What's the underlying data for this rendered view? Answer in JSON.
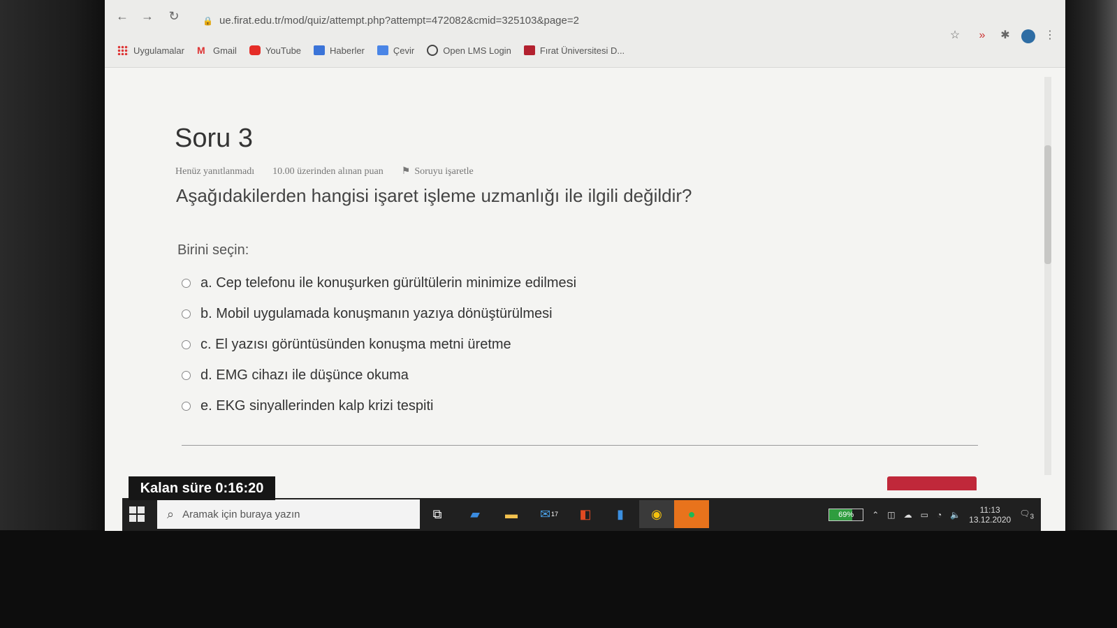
{
  "browser": {
    "url": "ue.firat.edu.tr/mod/quiz/attempt.php?attempt=472082&cmid=325103&page=2",
    "bookmarks": [
      {
        "label": "Uygulamalar",
        "icon": "apps-grid-icon"
      },
      {
        "label": "Gmail",
        "icon": "gmail-icon"
      },
      {
        "label": "YouTube",
        "icon": "youtube-icon"
      },
      {
        "label": "Haberler",
        "icon": "news-icon"
      },
      {
        "label": "Çevir",
        "icon": "translate-icon"
      },
      {
        "label": "Open LMS Login",
        "icon": "globe-icon"
      },
      {
        "label": "Fırat Üniversitesi D...",
        "icon": "firat-logo-icon"
      }
    ]
  },
  "quiz": {
    "title": "Soru 3",
    "status": "Henüz yanıtlanmadı",
    "points": "10.00 üzerinden alınan puan",
    "flag_label": "Soruyu işaretle",
    "question": "Aşağıdakilerden hangisi işaret işleme uzmanlığı ile ilgili değildir?",
    "prompt": "Birini seçin:",
    "options": [
      "a. Cep telefonu ile konuşurken gürültülerin minimize edilmesi",
      "b. Mobil uygulamada konuşmanın yazıya dönüştürülmesi",
      "c. El yazısı görüntüsünden konuşma metni üretme",
      "d. EMG cihazı ile düşünce okuma",
      "e. EKG sinyallerinden kalp krizi tespiti"
    ],
    "timer": "Kalan süre 0:16:20"
  },
  "taskbar": {
    "search_placeholder": "Aramak için buraya yazın",
    "mail_badge": "17",
    "battery": "69%",
    "battery_level": 0.69,
    "time": "11:13",
    "date": "13.12.2020",
    "notification_count": "3"
  }
}
